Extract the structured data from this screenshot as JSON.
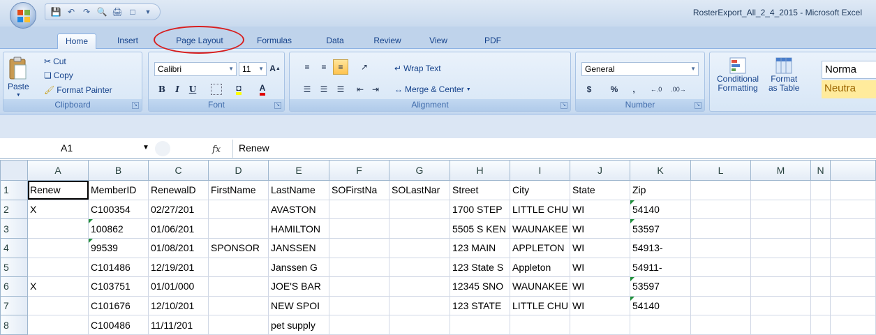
{
  "title": "RosterExport_All_2_4_2015 - Microsoft Excel",
  "tabs": [
    "Home",
    "Insert",
    "Page Layout",
    "Formulas",
    "Data",
    "Review",
    "View",
    "PDF"
  ],
  "active_tab": "Home",
  "ribbon": {
    "clipboard": {
      "label": "Clipboard",
      "paste": "Paste",
      "cut": "Cut",
      "copy": "Copy",
      "format_painter": "Format Painter"
    },
    "font": {
      "label": "Font",
      "font_name": "Calibri",
      "font_size": "11",
      "bold": "B",
      "italic": "I",
      "underline": "U",
      "font_color_letter": "A"
    },
    "alignment": {
      "label": "Alignment",
      "wrap_text": "Wrap Text",
      "merge_center": "Merge & Center"
    },
    "number": {
      "label": "Number",
      "format": "General",
      "currency": "$",
      "percent": "%",
      "comma": ",",
      "inc_decimal": ".00→.0",
      "dec_decimal": ".0→.00"
    },
    "styles": {
      "conditional_formatting_1": "Conditional",
      "conditional_formatting_2": "Formatting",
      "format_as_table_1": "Format",
      "format_as_table_2": "as Table",
      "normal": "Norma",
      "neutral": "Neutra"
    }
  },
  "formula_bar": {
    "name_box": "A1",
    "fx": "fx",
    "value": "Renew"
  },
  "columns": [
    "A",
    "B",
    "C",
    "D",
    "E",
    "F",
    "G",
    "H",
    "I",
    "J",
    "K",
    "L",
    "M",
    "N"
  ],
  "rows": [
    {
      "num": "1",
      "cells": [
        "Renew",
        "MemberID",
        "RenewalD",
        "FirstName",
        "LastName",
        "SOFirstNa",
        "SOLastNar",
        "Street",
        "City",
        "State",
        "Zip",
        "",
        "",
        ""
      ]
    },
    {
      "num": "2",
      "cells": [
        "X",
        "C100354",
        "02/27/201",
        "",
        "AVASTON",
        "",
        "",
        "1700 STEP",
        "LITTLE CHU",
        "WI",
        "54140",
        "",
        "",
        ""
      ]
    },
    {
      "num": "3",
      "cells": [
        "",
        "100862",
        "01/06/201",
        "",
        "HAMILTON",
        "",
        "",
        "5505 S KEN",
        "WAUNAKEE",
        "WI",
        "53597",
        "",
        "",
        ""
      ]
    },
    {
      "num": "4",
      "cells": [
        "",
        "99539",
        "01/08/201",
        "SPONSOR",
        "JANSSEN",
        "",
        "",
        "123 MAIN",
        "APPLETON",
        "WI",
        "54913-",
        "",
        "",
        ""
      ]
    },
    {
      "num": "5",
      "cells": [
        "",
        "C101486",
        "12/19/201",
        "",
        "Janssen G",
        "",
        "",
        "123 State S",
        "Appleton",
        "WI",
        "54911-",
        "",
        "",
        ""
      ]
    },
    {
      "num": "6",
      "cells": [
        "X",
        "C103751",
        "01/01/000",
        "",
        "JOE'S BAR",
        "",
        "",
        "12345 SNO",
        "WAUNAKEE",
        "WI",
        "53597",
        "",
        "",
        ""
      ]
    },
    {
      "num": "7",
      "cells": [
        "",
        "C101676",
        "12/10/201",
        "",
        "NEW SPOI",
        "",
        "",
        "123 STATE",
        "LITTLE CHU",
        "WI",
        "54140",
        "",
        "",
        ""
      ]
    },
    {
      "num": "8",
      "cells": [
        "",
        "C100486",
        "11/11/201",
        "",
        "pet supply",
        "",
        "",
        "",
        "",
        "",
        "",
        "",
        "",
        ""
      ]
    }
  ],
  "green_triangle_cells": [
    "2-10",
    "3-1",
    "3-10",
    "4-1",
    "6-10",
    "7-10"
  ]
}
